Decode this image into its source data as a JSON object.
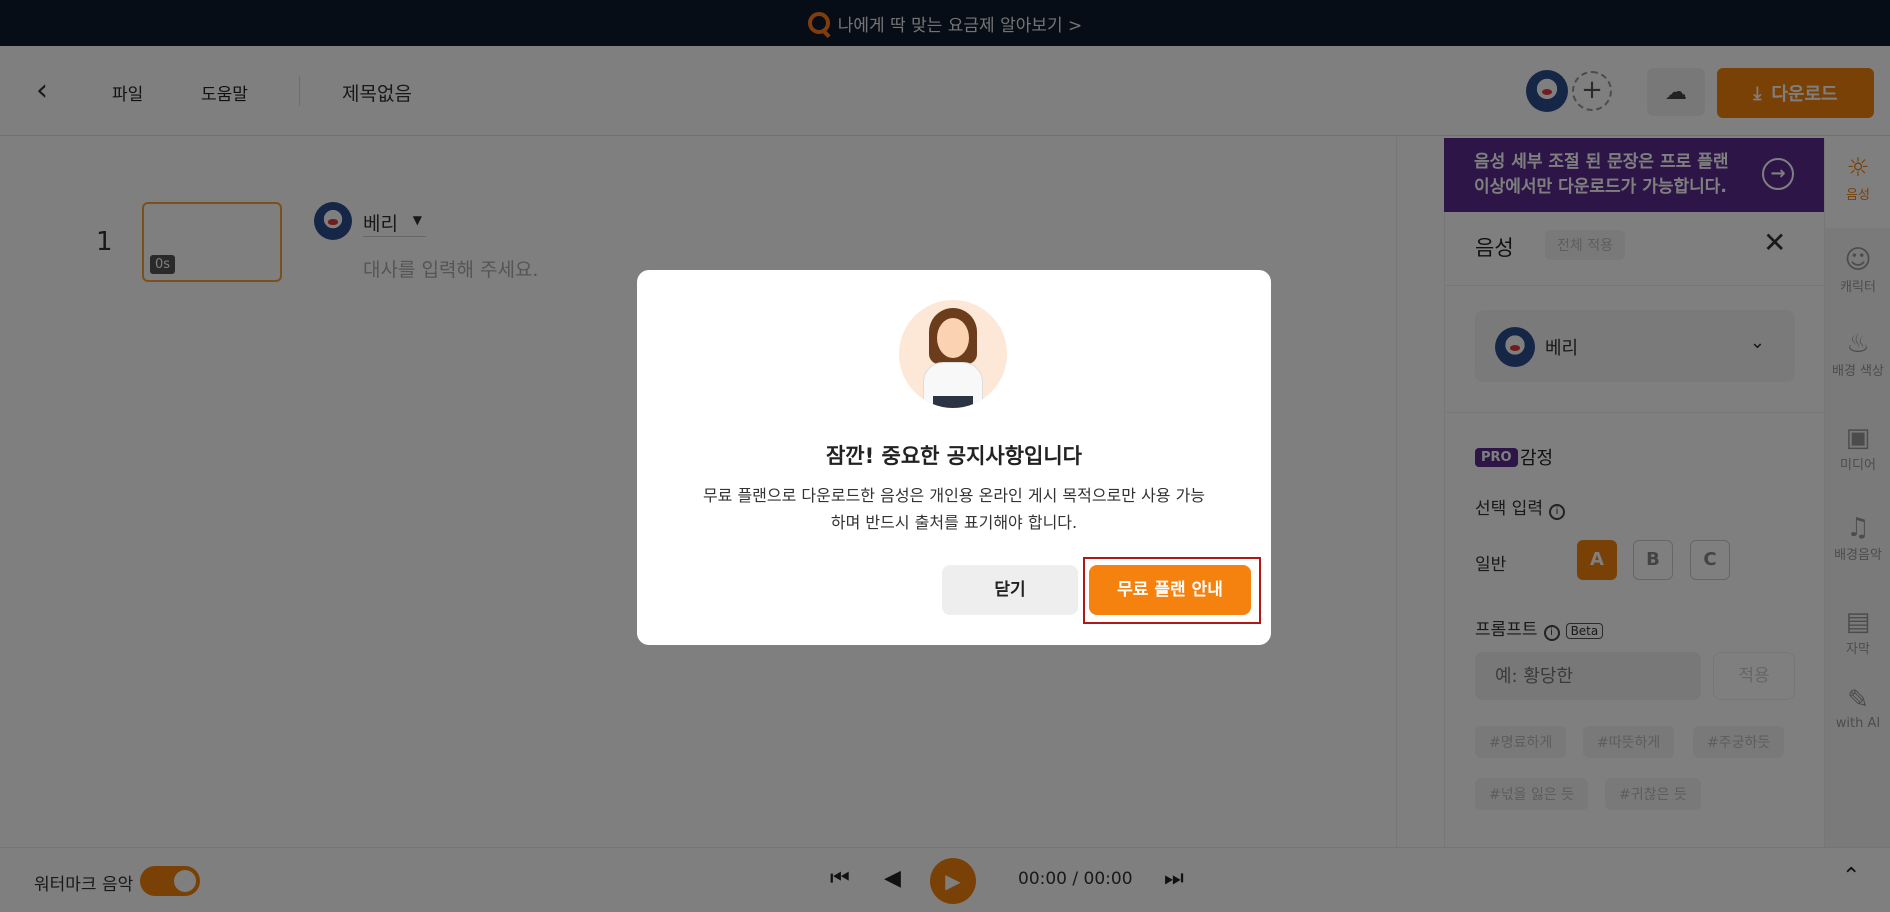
{
  "banner": {
    "text": "나에게 딱 맞는 요금제 알아보기 >"
  },
  "header": {
    "menu": [
      "파일",
      "도움말"
    ],
    "doc_title": "제목없음",
    "download_label": "다운로드"
  },
  "editor": {
    "row_number": "1",
    "thumb_time": "0s",
    "voice_name": "베리",
    "script_placeholder": "대사를 입력해 주세요."
  },
  "right_panel": {
    "notice": "음성 세부 조절 된 문장은 프로 플랜 이상에서만 다운로드가 가능합니다.",
    "title": "음성",
    "apply_all": "전체 적용",
    "voice_name": "베리",
    "pro_badge": "PRO",
    "emotion_label": "감정",
    "select_input_label": "선택 입력",
    "normal_label": "일반",
    "options": [
      "A",
      "B",
      "C"
    ],
    "prompt_label": "프롬프트",
    "beta_label": "Beta",
    "prompt_placeholder": "예: 황당한",
    "apply_label": "적용",
    "tags": [
      "#명료하게",
      "#따뜻하게",
      "#주궁하듯",
      "#넋을 잃은 듯",
      "#귀찮은 듯"
    ]
  },
  "rail": [
    {
      "label": "음성",
      "icon": "voice-icon"
    },
    {
      "label": "캐릭터",
      "icon": "character-icon"
    },
    {
      "label": "배경 색상",
      "icon": "paint-bucket-icon"
    },
    {
      "label": "미디어",
      "icon": "image-icon"
    },
    {
      "label": "배경음악",
      "icon": "music-icon"
    },
    {
      "label": "자막",
      "icon": "cc-icon"
    },
    {
      "label": "with AI",
      "icon": "ai-pen-icon"
    }
  ],
  "player": {
    "watermark_label": "워터마크 음악",
    "time": "00:00 / 00:00"
  },
  "modal": {
    "title": "잠깐! 중요한 공지사항입니다",
    "body": "무료 플랜으로 다운로드한 음성은 개인용 온라인 게시 목적으로만 사용 가능하며 반드시 출처를 표기해야 합니다.",
    "close_label": "닫기",
    "plan_label": "무료 플랜 안내"
  },
  "colors": {
    "accent": "#f5820f",
    "pro_purple": "#5b2c8f",
    "banner_bg": "#0d1b2e"
  }
}
